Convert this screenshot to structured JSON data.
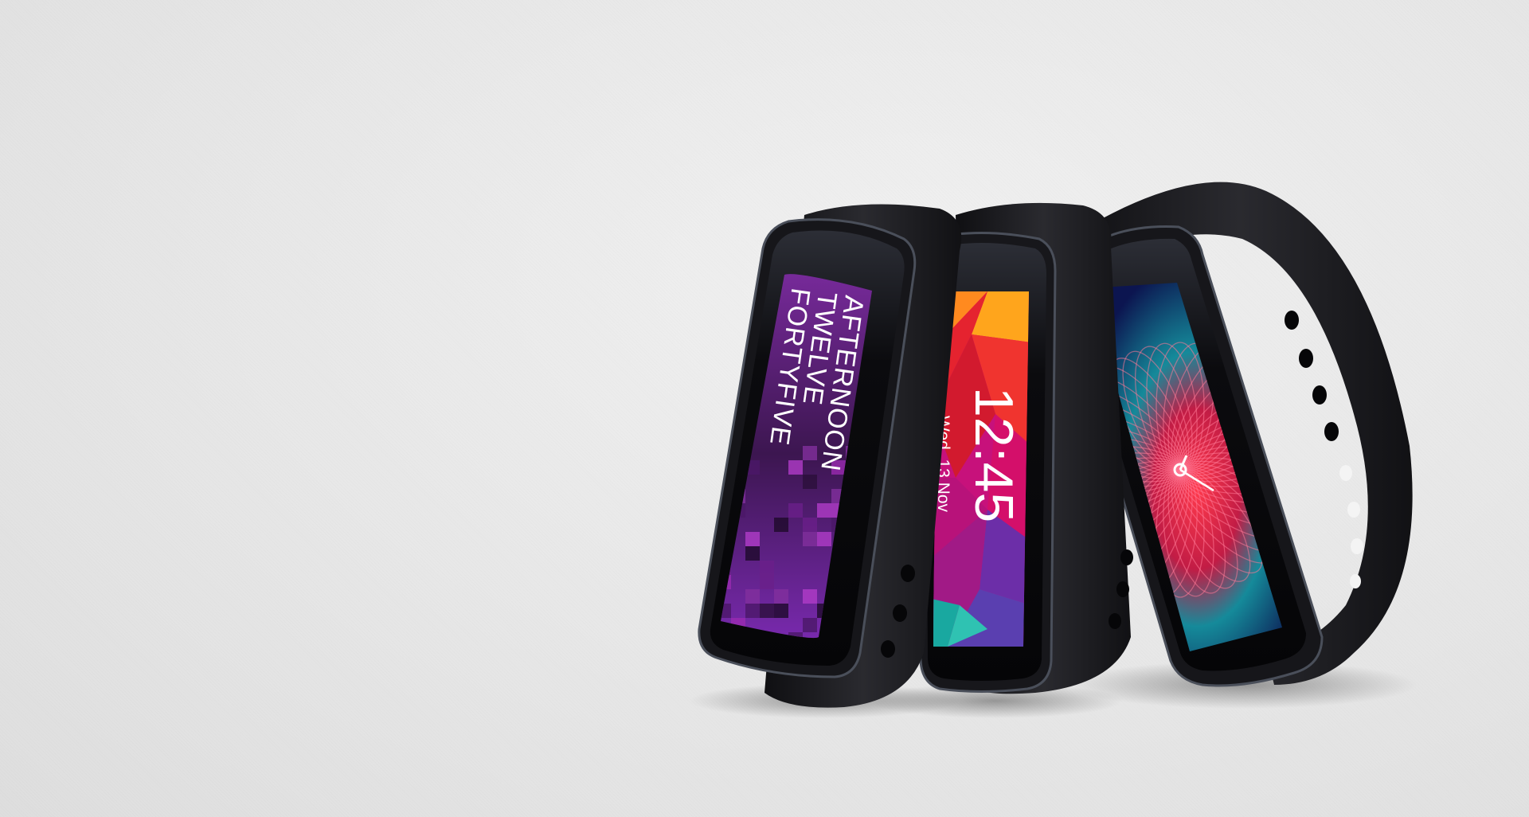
{
  "scene": {
    "background_color": "#e6e6e6",
    "band_color": "#1b1b1e"
  },
  "bands": [
    {
      "name": "left",
      "watch_face": "pixel-purple",
      "lines": [
        "AFTERNOON",
        "TWELVE",
        "FORTYFIVE"
      ],
      "colors": [
        "#6a1f8a",
        "#9a2bb0",
        "#2a0f3a"
      ]
    },
    {
      "name": "center",
      "watch_face": "geometric-color",
      "time": "12:45",
      "date": "Wed, 13 Nov",
      "colors": [
        "#ff8a1f",
        "#e5232f",
        "#c4117c",
        "#5a3fb0",
        "#19a8a0"
      ]
    },
    {
      "name": "right",
      "watch_face": "radial-mesh-analog",
      "colors": [
        "#0e1d5a",
        "#1aa5b0",
        "#e0273e"
      ]
    }
  ]
}
